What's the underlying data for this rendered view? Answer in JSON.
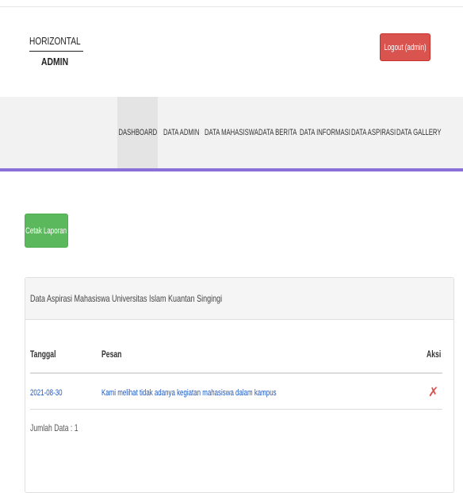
{
  "header": {
    "brand_line1": "HORIZONTAL",
    "brand_line2": "ADMIN",
    "logout_label": "Logout (admin)"
  },
  "nav": {
    "items": [
      {
        "label": "DASHBOARD",
        "active": true
      },
      {
        "label": "DATA ADMIN"
      },
      {
        "label": "DATA MAHASISWA"
      },
      {
        "label": "DATA BERITA"
      },
      {
        "label": "DATA INFORMASI"
      },
      {
        "label": "DATA ASPIRASI"
      },
      {
        "label": "DATA GALLERY"
      }
    ]
  },
  "actions": {
    "print_label": "Cetak Laporan"
  },
  "panel": {
    "title": "Data Aspirasi Mahasiswa Universitas Islam Kuantan Singingi",
    "columns": [
      "Tanggal",
      "Pesan",
      "Aksi"
    ],
    "rows": [
      {
        "date": "2021-08-30",
        "message": "Kami melihat tidak adanya kegiatan mahasiswa dalam kampus",
        "action_icon": "delete-icon"
      }
    ],
    "total_label": "Jumlah Data : 1"
  },
  "colors": {
    "logout_button": "#d9534f",
    "print_button": "#5cb85c",
    "nav_accent": "#8a6fd8",
    "link": "#1a57c4"
  }
}
